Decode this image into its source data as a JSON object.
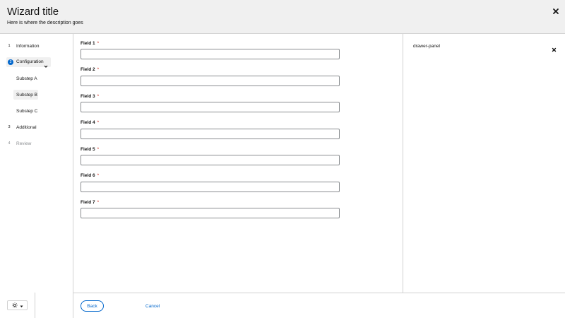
{
  "header": {
    "title": "Wizard title",
    "description": "Here is where the description goes",
    "close_icon": "close-icon"
  },
  "nav": {
    "steps": [
      {
        "number": "1",
        "label": "Information",
        "state": "default"
      },
      {
        "number": "2",
        "label": "Configuration",
        "state": "current",
        "expanded": true
      },
      {
        "number": "3",
        "label": "Additional",
        "state": "default"
      },
      {
        "number": "4",
        "label": "Review",
        "state": "disabled"
      }
    ],
    "substeps": [
      {
        "label": "Substep A",
        "active": false
      },
      {
        "label": "Substep B",
        "active": true
      },
      {
        "label": "Substep C",
        "active": false
      }
    ]
  },
  "form": {
    "required_marker": "*",
    "fields": [
      {
        "label": "Field 1",
        "value": ""
      },
      {
        "label": "Field 2",
        "value": ""
      },
      {
        "label": "Field 3",
        "value": ""
      },
      {
        "label": "Field 4",
        "value": ""
      },
      {
        "label": "Field 5",
        "value": ""
      },
      {
        "label": "Field 6",
        "value": ""
      },
      {
        "label": "Field 7",
        "value": ""
      }
    ]
  },
  "drawer": {
    "text": "drawer-panel",
    "close_icon": "close-icon"
  },
  "footer": {
    "back_label": "Back",
    "cancel_label": "Cancel"
  },
  "theme_toggle": {
    "icon": "sun-icon",
    "caret": "caret-down-icon"
  },
  "colors": {
    "accent": "#0066cc",
    "required": "#c9190b",
    "header_bg": "#f0f0f0",
    "border": "#d2d2d2",
    "disabled": "#8a8d90"
  }
}
